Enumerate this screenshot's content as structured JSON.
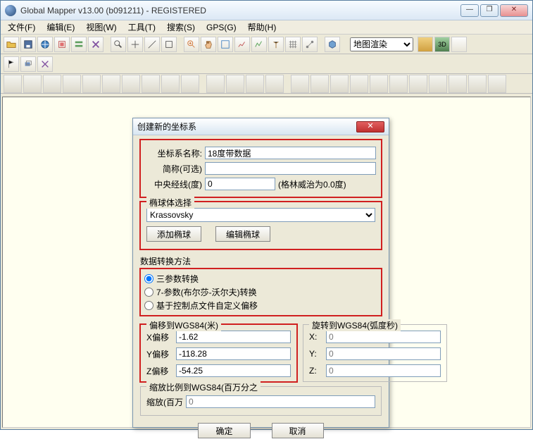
{
  "titlebar": {
    "title": "Global Mapper v13.00 (b091211) - REGISTERED"
  },
  "menubar": {
    "file": "文件(F)",
    "edit": "编辑(E)",
    "view": "视图(W)",
    "tools": "工具(T)",
    "search": "搜索(S)",
    "gps": "GPS(G)",
    "help": "帮助(H)"
  },
  "toolbar": {
    "map_render": "地图渲染"
  },
  "dialog": {
    "title": "创建新的坐标系",
    "name_section": {
      "name_label": "坐标系名称:",
      "name_value": "18度带数据",
      "short_label": "简称(可选)",
      "short_value": "",
      "cm_label": "中央经线(度)",
      "cm_value": "0",
      "cm_hint": "(格林威治为0.0度)"
    },
    "ellipsoid": {
      "legend": "椭球体选择",
      "selected": "Krassovsky",
      "add_btn": "添加椭球",
      "edit_btn": "编辑椭球"
    },
    "datum_method": {
      "legend": "数据转换方法",
      "opt1": "三参数转换",
      "opt2": "7-参数(布尔莎-沃尔夫)转换",
      "opt3": "基于控制点文件自定义偏移"
    },
    "offset": {
      "legend": "偏移到WGS84(米)",
      "x_label": "X偏移",
      "x_val": "-1.62",
      "y_label": "Y偏移",
      "y_val": "-118.28",
      "z_label": "Z偏移",
      "z_val": "-54.25"
    },
    "rotation": {
      "legend": "旋转到WGS84(弧度秒)",
      "x_label": "X:",
      "x_val": "0",
      "y_label": "Y:",
      "y_val": "0",
      "z_label": "Z:",
      "z_val": "0"
    },
    "scale": {
      "legend": "缩放比例到WGS84(百万分之",
      "label": "缩放(百万",
      "val": "0"
    },
    "buttons": {
      "ok": "确定",
      "cancel": "取消"
    }
  }
}
